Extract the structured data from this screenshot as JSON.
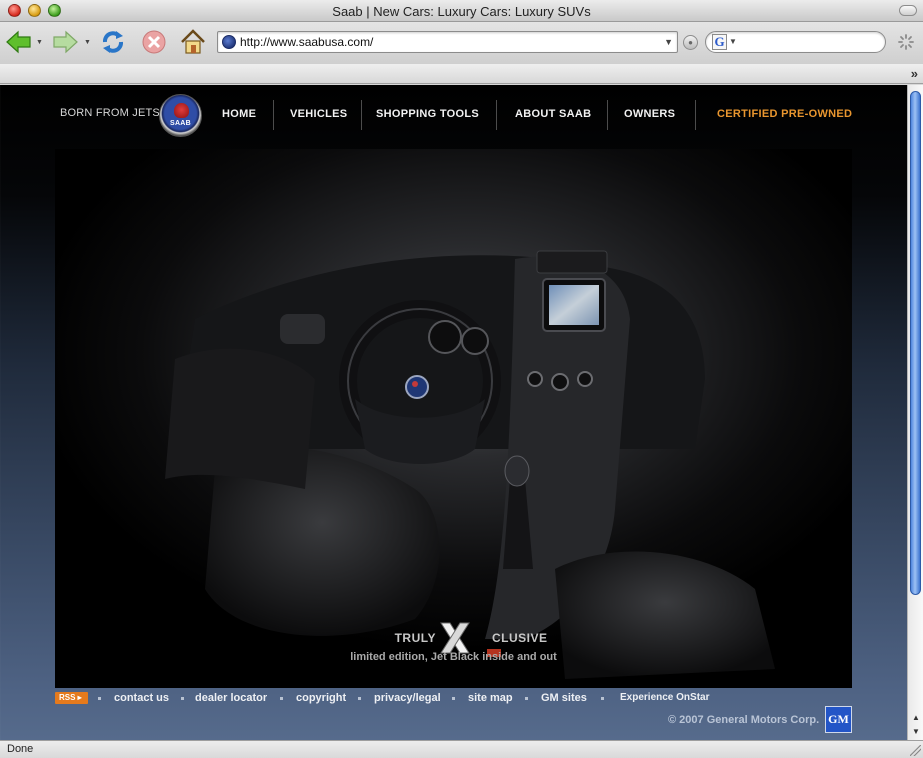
{
  "window": {
    "title": "Saab | New Cars: Luxury Cars: Luxury SUVs"
  },
  "toolbar": {
    "url": "http://www.saabusa.com/",
    "icons": [
      "back-arrow-icon",
      "forward-arrow-icon",
      "reload-icon",
      "stop-icon",
      "home-icon",
      "go-icon",
      "google-search-icon",
      "loading-spinner-icon"
    ]
  },
  "site": {
    "brand_tagline": "BORN FROM JETS",
    "logo_text": "SAAB",
    "nav": [
      {
        "label": "HOME"
      },
      {
        "label": "VEHICLES"
      },
      {
        "label": "SHOPPING TOOLS"
      },
      {
        "label": "ABOUT SAAB"
      },
      {
        "label": "OWNERS"
      },
      {
        "label": "CERTIFIED PRE-OWNED"
      }
    ],
    "hero": {
      "tagline_left": "TRULY",
      "tagline_right": "CLUSIVE",
      "subline": "limited edition, Jet Black inside and out"
    },
    "footer": {
      "rss": "RSS",
      "links": [
        {
          "label": "contact us"
        },
        {
          "label": "dealer locator"
        },
        {
          "label": "copyright"
        },
        {
          "label": "privacy/legal"
        },
        {
          "label": "site map"
        },
        {
          "label": "GM sites"
        },
        {
          "label": "Experience OnStar"
        }
      ],
      "copyright": "© 2007 General Motors Corp.",
      "gm_logo_text": "GM"
    },
    "colors": {
      "accent_orange": "#e9962f",
      "rss_orange": "#e57a1c",
      "nav_text": "#f2f2f2",
      "gm_blue": "#2355c7"
    }
  },
  "status": {
    "text": "Done"
  }
}
